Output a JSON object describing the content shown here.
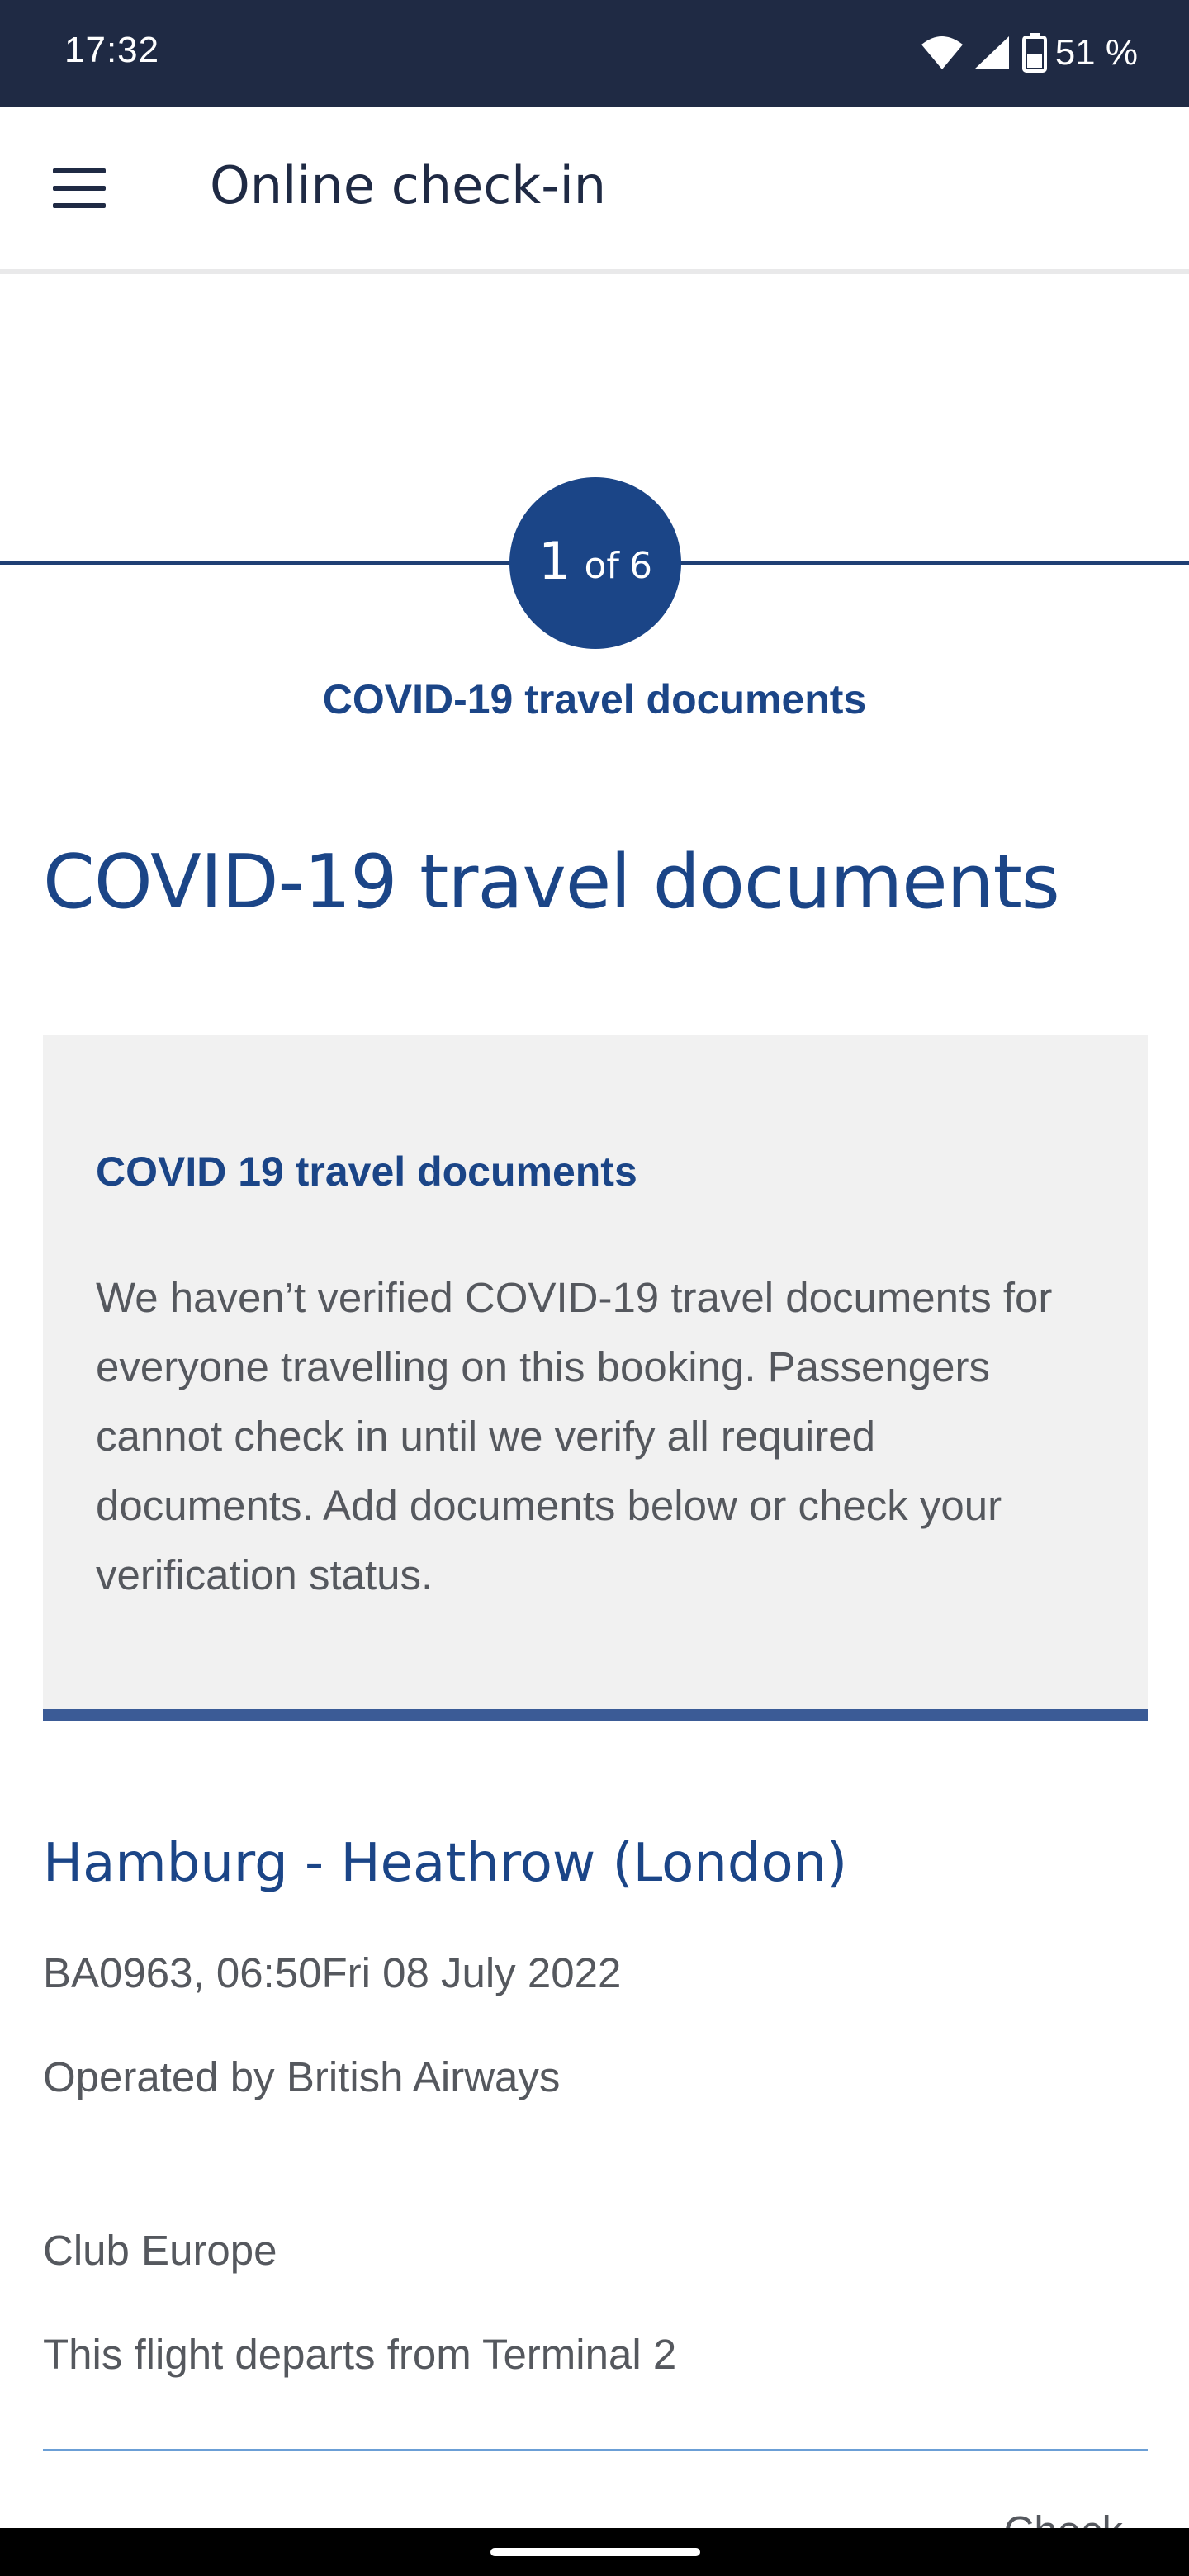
{
  "status_bar": {
    "time": "17:32",
    "battery_percent": "51 %"
  },
  "app_bar": {
    "title": "Online check-in"
  },
  "stepper": {
    "current": "1",
    "of_word": "of",
    "total": "6",
    "label": "COVID-19 travel documents"
  },
  "page": {
    "title": "COVID-19 travel documents"
  },
  "info_box": {
    "title": "COVID 19 travel documents",
    "body": "We haven’t verified COVID-19 travel documents for everyone travelling on this booking. Passengers cannot check in until we verify all required documents. Add documents below or check your verification status."
  },
  "flight": {
    "route": "Hamburg - Heathrow (London)",
    "flight_line": "BA0963, 06:50Fri 08 July 2022",
    "operated_by": "Operated by British Airways",
    "cabin": "Club Europe",
    "terminal": "This flight departs from Terminal 2",
    "check_link": "Check"
  },
  "colors": {
    "status_bar_bg": "#1f2a44",
    "brand_blue": "#1b4587",
    "info_box_bg": "#f1f1f1",
    "info_box_border": "#3b5b96",
    "body_text": "#55585e"
  },
  "icons": [
    "menu-icon",
    "wifi-icon",
    "signal-icon",
    "battery-icon"
  ]
}
